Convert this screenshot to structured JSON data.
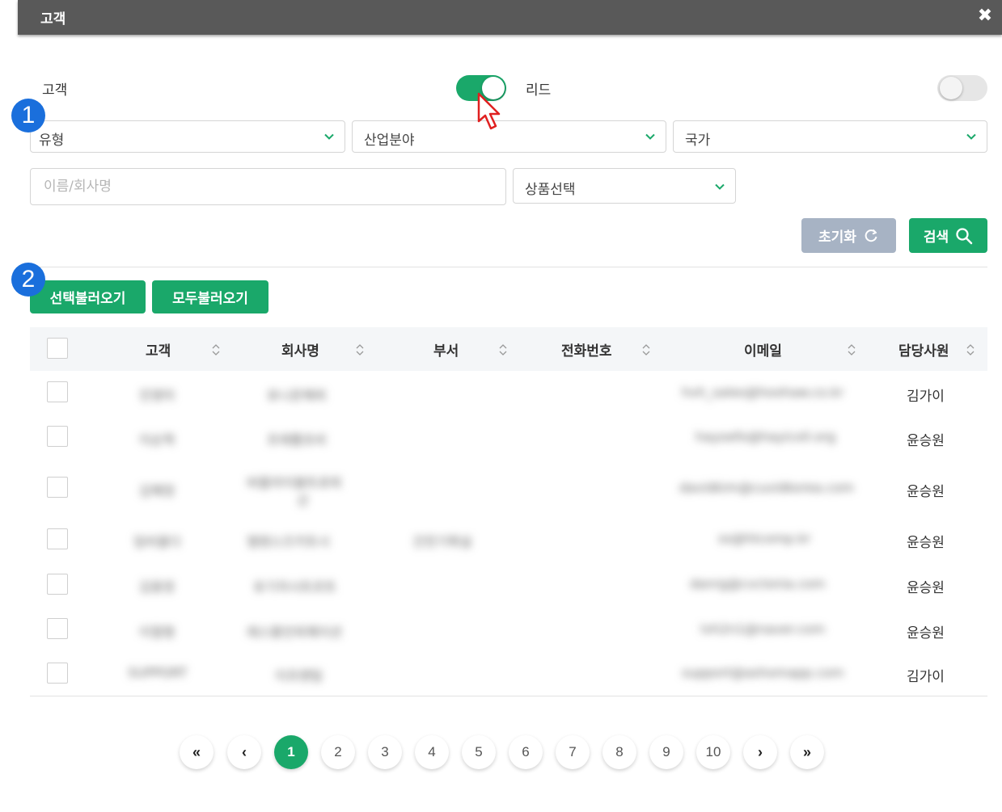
{
  "window": {
    "title": "고객"
  },
  "filters": {
    "customer_label": "고객",
    "lead_label": "리드",
    "customer_toggle": "on",
    "lead_toggle": "off",
    "type_select": "유형",
    "industry_select": "산업분야",
    "country_select": "국가",
    "name_placeholder": "이름/회사명",
    "product_select": "상품선택",
    "reset_label": "초기화",
    "search_label": "검색"
  },
  "badges": {
    "one": "1",
    "two": "2"
  },
  "actions": {
    "load_selected": "선택불러오기",
    "load_all": "모두불러오기"
  },
  "table": {
    "columns": [
      "고객",
      "회사명",
      "부서",
      "전화번호",
      "이메일",
      "담당사원"
    ],
    "rows": [
      {
        "customer": "진영미",
        "company": "유니온해피",
        "dept": "",
        "email": "hvh_sales@hoohaw.co.kr",
        "owner": "김가이"
      },
      {
        "customer": "이순혁",
        "company": "프레쁨초비",
        "dept": "",
        "email": "hayoefo@hayicoll.org",
        "owner": "윤승원"
      },
      {
        "customer": "김혜정",
        "company": "바를라이블트로피",
        "company2": "산",
        "dept": "",
        "email": "davidkim@cuvidkorea.com",
        "owner": "윤승원"
      },
      {
        "customer": "임비올다",
        "company": "엠렌스즈키트시",
        "dept": "건전기획실",
        "email": "ss@htcomp.kr",
        "owner": "윤승원"
      },
      {
        "customer": "김용정",
        "company": "유기자시트르트",
        "dept": "",
        "email": "danrg@cvclonia.com",
        "owner": "윤승원"
      },
      {
        "customer": "이철형",
        "company": "레스황안피해이션",
        "dept": "",
        "email": "lvh2n1@naver.com",
        "owner": "윤승원"
      },
      {
        "customer": "SUPPORT",
        "company": "이프랜텀",
        "dept": "",
        "email": "support@ashomapp.com",
        "owner": "김가이"
      }
    ]
  },
  "pagination": {
    "first": "«",
    "prev": "‹",
    "pages": [
      "1",
      "2",
      "3",
      "4",
      "5",
      "6",
      "7",
      "8",
      "9",
      "10"
    ],
    "current": "1",
    "next": "›",
    "last": "»"
  },
  "colors": {
    "primary_green": "#1aa86a",
    "reset_gray": "#a7b3c4",
    "titlebar": "#595959",
    "badge_blue": "#1a6fdc"
  }
}
